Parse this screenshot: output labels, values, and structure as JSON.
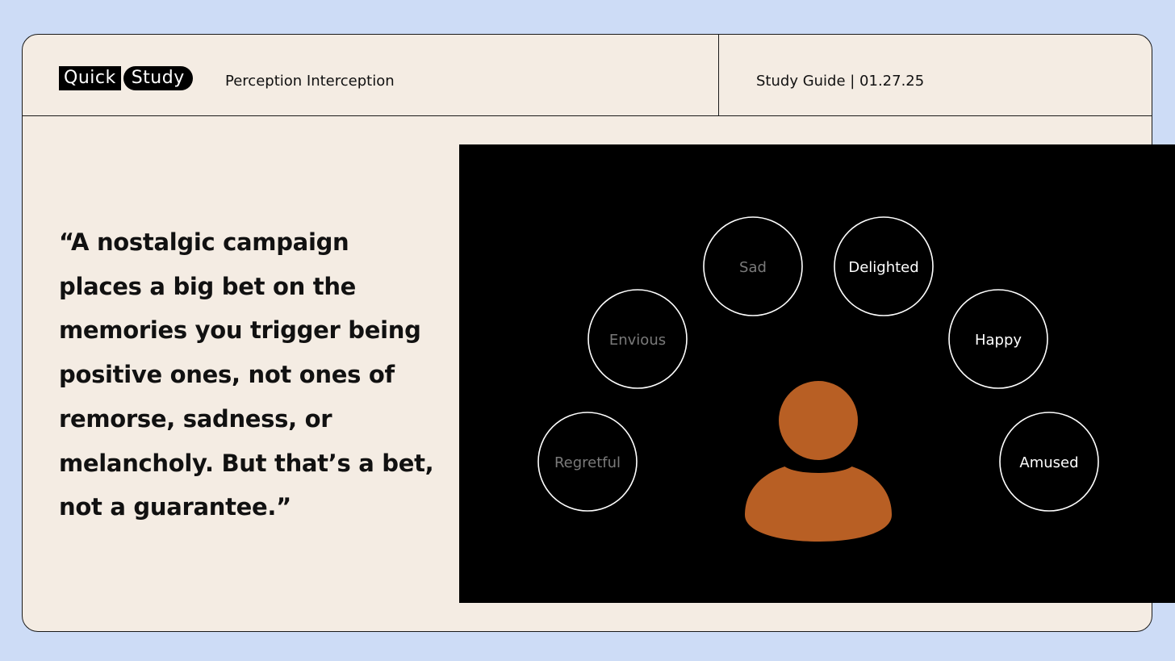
{
  "header": {
    "logo_quick": "Quick",
    "logo_study": "Study",
    "subject": "Perception Interception",
    "guide": "Study Guide | 01.27.25"
  },
  "quote": "“A nostalgic campaign places a big bet on the memories you trigger being positive ones, not ones of remorse, sadness, or melancholy. But that’s a bet, not a guarantee.”",
  "illustration": {
    "person_color": "#b85f24",
    "emotions": {
      "sad": "Sad",
      "delighted": "Delighted",
      "envious": "Envious",
      "happy": "Happy",
      "regretful": "Regretful",
      "amused": "Amused"
    },
    "negative_color": "#7a7a7a",
    "positive_color": "#ffffff"
  }
}
